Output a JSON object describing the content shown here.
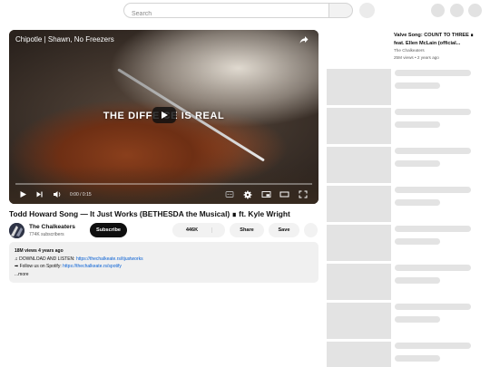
{
  "search": {
    "placeholder": "Search"
  },
  "player": {
    "title": "Chipotle | Shawn, No Freezers",
    "overlay_text": "THE DIFFE    CE IS REAL",
    "time": "0:00 / 0:15",
    "progress": 0
  },
  "video": {
    "title": "Todd Howard Song — It Just Works (BETHESDA the Musical) ∎ ft. Kyle Wright",
    "channel": "The Chalkeaters",
    "subscribers": "774K subscribers",
    "subscribe_label": "Subscribe",
    "likes": "446K",
    "share_label": "Share",
    "save_label": "Save"
  },
  "description": {
    "meta": "18M views  4 years ago",
    "line1_prefix": "♫ DOWNLOAD AND LISTEN: ",
    "line1_link": "https://thechalkeate.rs/itjustworks",
    "line2_prefix": "➡ Follow us on Spotify: ",
    "line2_link": "https://thechalkeate.rs/spotify",
    "more": "...more"
  },
  "recommendations": [
    {
      "title": "Valve Song: COUNT TO THREE ∎ feat. Ellen McLain (official...",
      "channel": "The Chalkeaters",
      "meta": "25M views  •  2 years ago"
    }
  ],
  "colors": {
    "accent_red": "#ff0000",
    "link": "#065fd4",
    "skeleton": "#e3e3e3"
  }
}
